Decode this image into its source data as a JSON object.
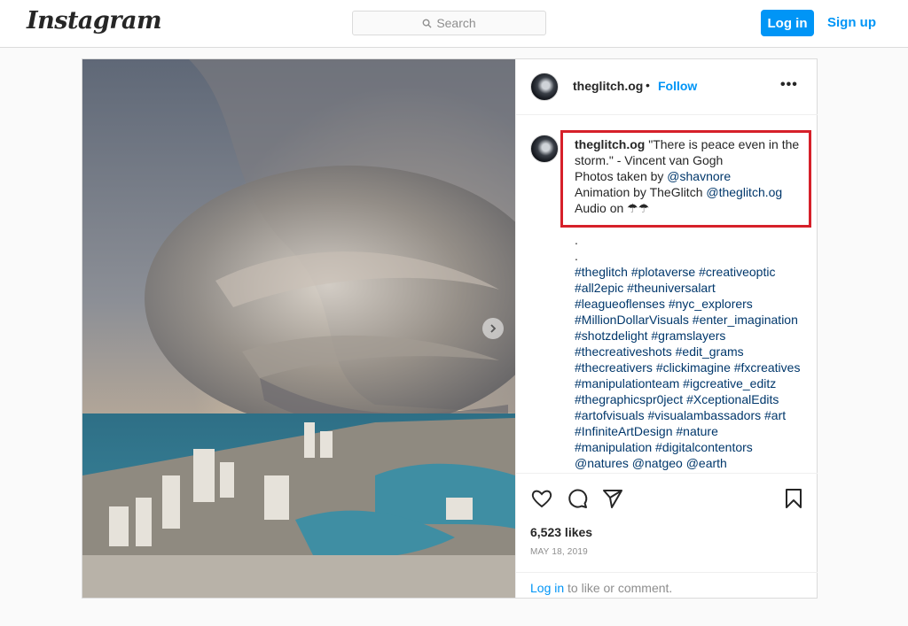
{
  "header": {
    "logo": "Instagram",
    "search_placeholder": "Search",
    "login_label": "Log in",
    "signup_label": "Sign up"
  },
  "post": {
    "username": "theglitch.og",
    "dot": "•",
    "follow_label": "Follow",
    "more_label": "•••",
    "caption": {
      "username": "theglitch.og",
      "quote": "\"There is peace even in the storm.\" - Vincent van Gogh",
      "photos_prefix": "Photos taken by ",
      "photos_mention": "@shavnore",
      "animation_prefix": "Animation by TheGlitch ",
      "animation_mention": "@theglitch.og",
      "audio": "Audio on ☂☂"
    },
    "dots": [
      ".",
      "."
    ],
    "hashtag_lines": [
      "#theglitch #plotaverse #creativeoptic",
      "#all2epic #theuniversalart",
      "#leagueoflenses #nyc_explorers",
      "#MillionDollarVisuals #enter_imagination",
      "#shotzdelight #gramslayers",
      "#thecreativeshots #edit_grams",
      "#thecreativers #clickimagine #fxcreatives",
      "#manipulationteam #igcreative_editz",
      "#thegraphicspr0ject #XceptionalEdits",
      "#artofvisuals #visualambassadors #art",
      "#InfiniteArtDesign #nature",
      "#manipulation #digitalcontentors",
      "@natures @natgeo @earth"
    ],
    "likes": "6,523 likes",
    "date": "MAY 18, 2019",
    "comment_login": "Log in",
    "comment_suffix": " to like or comment."
  },
  "icons": {
    "search": "search-icon",
    "next": "chevron-right-icon",
    "like": "heart-icon",
    "comment": "comment-icon",
    "share": "paper-plane-icon",
    "save": "bookmark-icon"
  },
  "colors": {
    "accent": "#0095f6",
    "highlight": "#d6202a",
    "mention": "#00376b"
  }
}
